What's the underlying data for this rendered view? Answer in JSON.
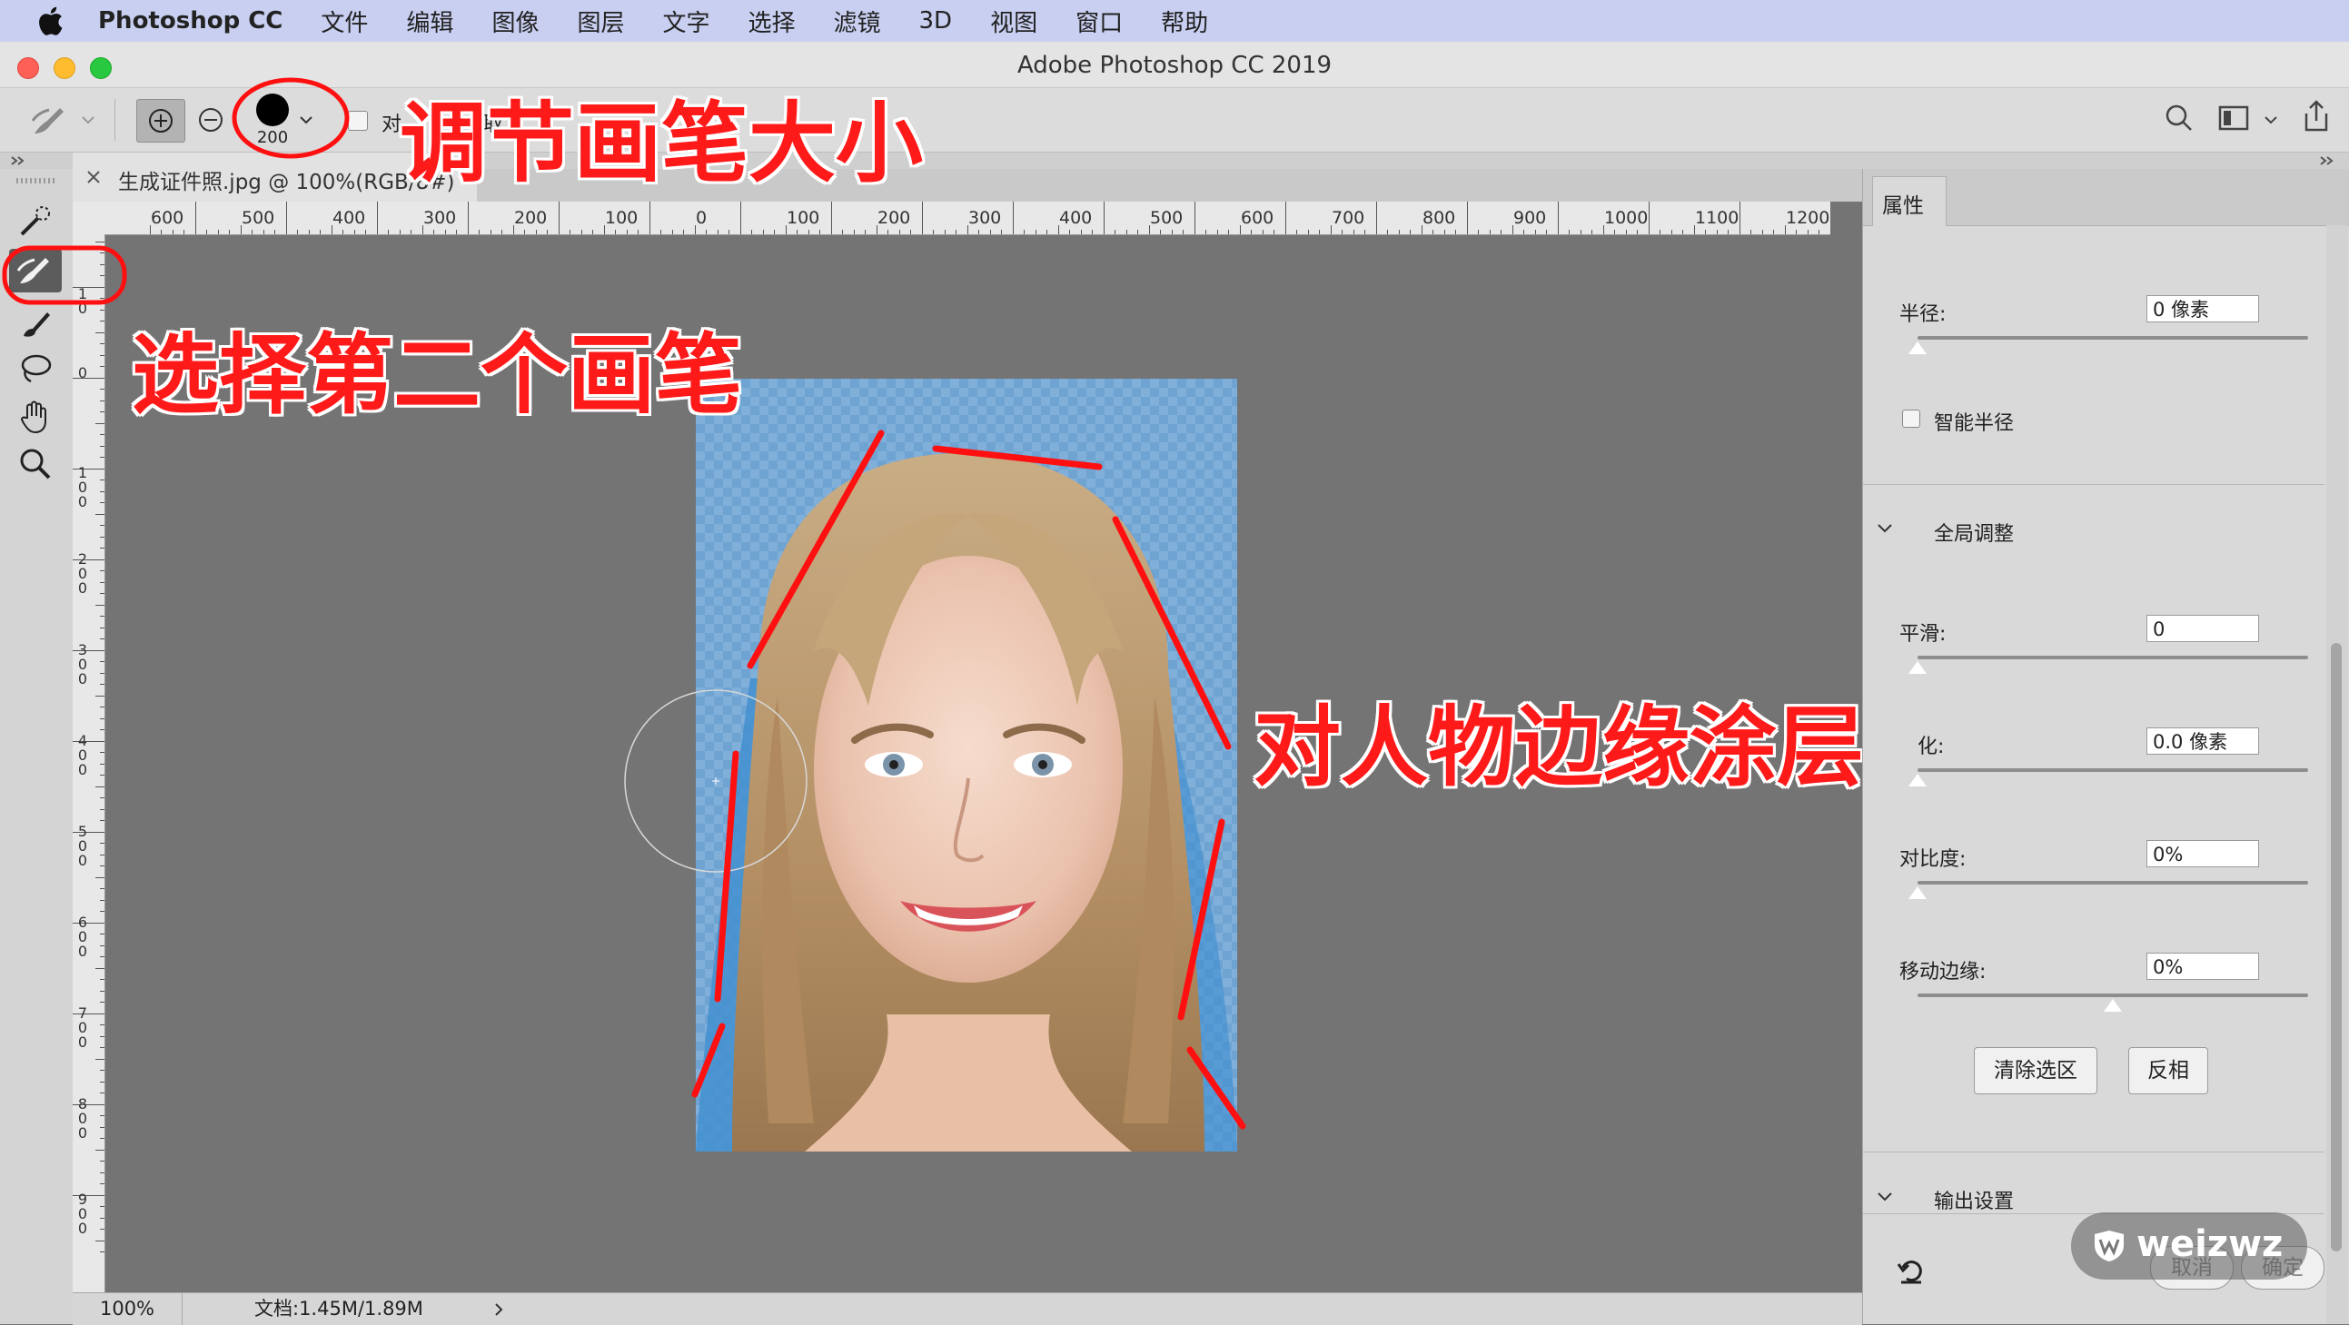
{
  "menubar": {
    "app_name": "Photoshop CC",
    "items": [
      "文件",
      "编辑",
      "图像",
      "图层",
      "文字",
      "选择",
      "滤镜",
      "3D",
      "视图",
      "窗口",
      "帮助"
    ]
  },
  "window": {
    "title": "Adobe Photoshop CC 2019"
  },
  "options_bar": {
    "brush_size": "200",
    "checkbox_label_1": "对",
    "checkbox_label_2": "取"
  },
  "document": {
    "tab_title": "生成证件照.jpg @ 100%(RGB/8#) *",
    "zoom": "100%",
    "doc_info": "文档:1.45M/1.89M"
  },
  "rulers": {
    "h_labels": [
      "600",
      "500",
      "400",
      "300",
      "200",
      "100",
      "0",
      "100",
      "200",
      "300",
      "400",
      "500",
      "600",
      "700",
      "800",
      "900",
      "1000",
      "1100",
      "1200"
    ],
    "v_labels": [
      "1\n0",
      "0",
      "1\n0\n0",
      "2\n0\n0",
      "3\n0\n0",
      "4\n0\n0",
      "5\n0\n0",
      "6\n0\n0",
      "7\n0\n0",
      "8\n0\n0",
      "9\n0\n0"
    ]
  },
  "panel": {
    "tab_label": "属性",
    "radius_label": "半径:",
    "radius_value": "0 像素",
    "smart_radius_label": "智能半径",
    "global_adjust_label": "全局调整",
    "smooth_label": "平滑:",
    "smooth_value": "0",
    "feather_label": "化:",
    "feather_value": "0.0 像素",
    "contrast_label": "对比度:",
    "contrast_value": "0%",
    "shift_edge_label": "移动边缘:",
    "shift_edge_value": "0%",
    "clear_selection_label": "清除选区",
    "invert_label": "反相",
    "output_settings_label": "输出设置",
    "cancel_label": "取消",
    "ok_label": "确定",
    "slider_levels": {
      "radius": 0,
      "smooth": 0,
      "feather": 0,
      "contrast": 0,
      "shift_edge": 0.5
    }
  },
  "annotations": {
    "adjust_brush_size": "调节画笔大小",
    "select_second_brush": "选择第二个画笔",
    "paint_edges": "对人物边缘涂层"
  },
  "watermark": {
    "text": "weizwz"
  },
  "colors": {
    "annotation_red": "#ff1a1a",
    "photo_bg_blue": "#6fa3d2",
    "canvas_gray": "#747474"
  }
}
